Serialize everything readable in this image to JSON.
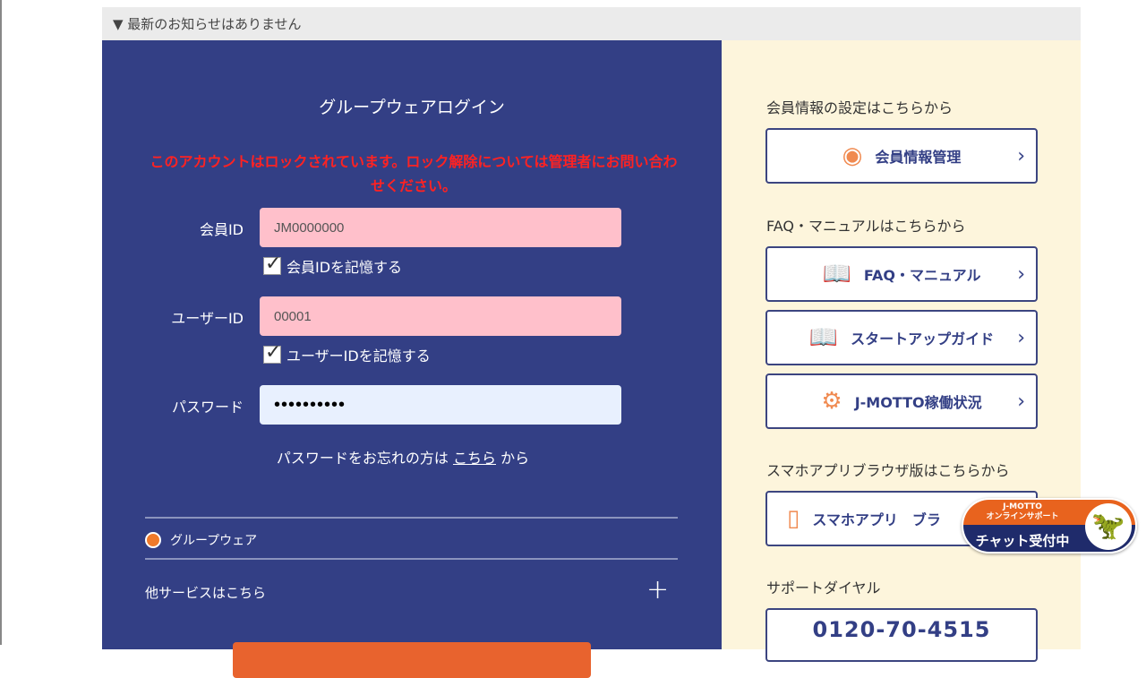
{
  "notice": "▼ 最新のお知らせはありません",
  "login": {
    "title": "グループウェアログイン",
    "error": "このアカウントはロックされています。ロック解除については管理者にお問い合わせください。",
    "member_id_label": "会員ID",
    "member_id_value": "JM0000000",
    "remember_member": "会員IDを記憶する",
    "user_id_label": "ユーザーID",
    "user_id_value": "00001",
    "remember_user": "ユーザーIDを記憶する",
    "password_label": "パスワード",
    "password_value": "••••••••••",
    "forgot_prefix": "パスワードをお忘れの方は ",
    "forgot_link": "こちら",
    "forgot_suffix": " から",
    "service_option": "グループウェア",
    "other_services": "他サービスはこちら",
    "plus": "+"
  },
  "side": {
    "member_heading": "会員情報の設定はこちらから",
    "member_button": "会員情報管理",
    "faq_heading": "FAQ・マニュアルはこちらから",
    "faq_button": "FAQ・マニュアル",
    "startup_button": "スタートアップガイド",
    "status_button": "J-MOTTO稼働状況",
    "app_heading": "スマホアプリブラウザ版はこちらから",
    "app_button": "スマホアプリ　ブラ",
    "support_heading": "サポートダイヤル",
    "support_phone": "0120-70-4515"
  },
  "chat": {
    "brand": "J-MOTTO",
    "subtitle": "オンラインサポート",
    "status": "チャット受付中"
  }
}
